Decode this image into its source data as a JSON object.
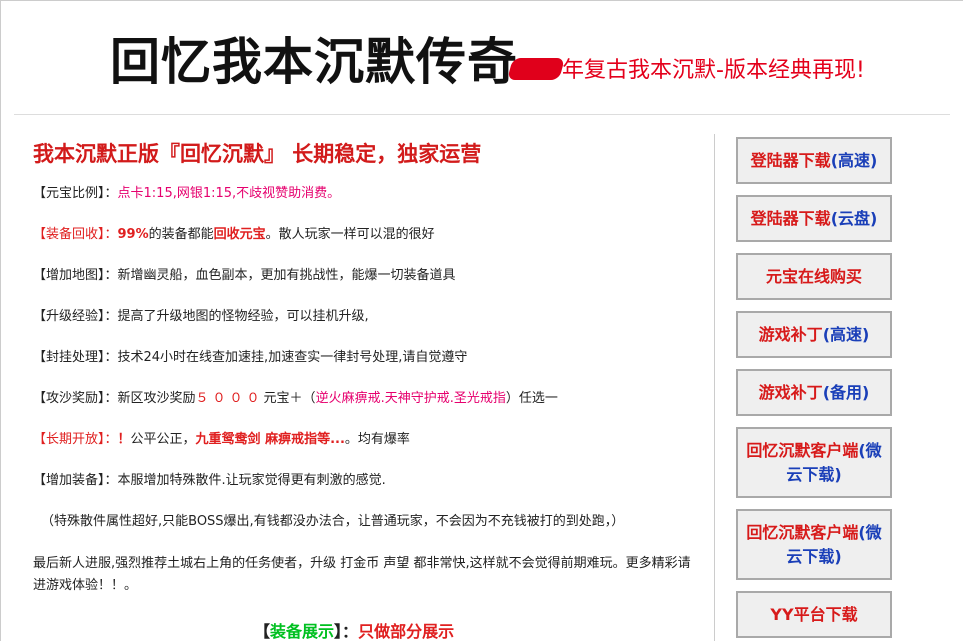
{
  "header": {
    "title": "回忆我本沉默传奇",
    "tagline": "年复古我本沉默-版本经典再现!"
  },
  "main": {
    "title": "我本沉默正版『回忆沉默』 长期稳定，独家运营",
    "rows": {
      "yuanbao": {
        "label": "【元宝比例】：",
        "text": "点卡1:15,网银1:15,不歧视赞助消费。"
      },
      "recycle": {
        "label": "【装备回收】：",
        "pct": "99%",
        "text1": "的装备都能",
        "hl": "回收元宝",
        "text2": "。散人玩家一样可以混的很好"
      },
      "maps": {
        "label": "【增加地图】：",
        "text": "新增幽灵船，血色副本，更加有挑战性，能爆一切装备道具"
      },
      "exp": {
        "label": "【升级经验】：",
        "text": "提高了升级地图的怪物经验，可以挂机升级,"
      },
      "ban": {
        "label": "【封挂处理】：",
        "text": "技术24小时在线查加速挂,加速查实一律封号处理,请自觉遵守"
      },
      "siege": {
        "label": "【攻沙奖励】：",
        "text1": "新区攻沙奖励",
        "amount": "５０００",
        "text2": "元宝＋（",
        "items": "逆火麻痹戒.天神守护戒.圣光戒指",
        "text3": "）任选一"
      },
      "open": {
        "label": "【长期开放】：",
        "excl": "！",
        "text1": "公平公正，",
        "items": "九重鸳鸯剑 麻痹戒指等...",
        "text2": "。均有爆率"
      },
      "gear": {
        "label": "【增加装备】：",
        "text": "本服增加特殊散件.让玩家觉得更有刺激的感觉."
      }
    },
    "note": "（特殊散件属性超好,只能BOSS爆出,有钱都没办法合，让普通玩家，不会因为不充钱被打的到处跑，）",
    "paragraph": "最后新人进服,强烈推荐土城右上角的任务使者，升级 打金币 声望 都非常快,这样就不会觉得前期难玩。更多精彩请进游戏体验！！。",
    "equip": {
      "open": "【",
      "label": "装备展示",
      "close": "】",
      "colon": "：",
      "text": "只做部分展示"
    }
  },
  "sidebar": [
    {
      "red": "登陆器下载",
      "blue": "(高速)"
    },
    {
      "red": "登陆器下载",
      "blue": "(云盘)"
    },
    {
      "red": "元宝在线购买",
      "blue": ""
    },
    {
      "red": "游戏补丁",
      "blue": "(高速)"
    },
    {
      "red": "游戏补丁",
      "blue": "(备用)"
    },
    {
      "red": "回忆沉默客户端",
      "blue": "(微云下载)"
    },
    {
      "red": "回忆沉默客户端",
      "blue": "(微云下载)"
    },
    {
      "red": "YY平台下载",
      "blue": ""
    }
  ],
  "colors": {
    "accent_red": "#d71a1a",
    "link_blue": "#1a3fb8",
    "pink": "#e6006e",
    "green": "#00c020"
  }
}
